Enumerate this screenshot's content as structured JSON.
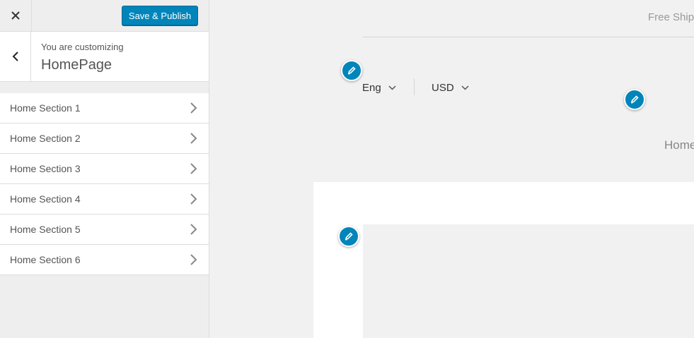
{
  "header": {
    "close_icon": "close-icon",
    "publish_label": "Save & Publish"
  },
  "info": {
    "customizing_label": "You are customizing",
    "page_title": "HomePage"
  },
  "sections": [
    {
      "label": "Home Section 1"
    },
    {
      "label": "Home Section 2"
    },
    {
      "label": "Home Section 3"
    },
    {
      "label": "Home Section 4"
    },
    {
      "label": "Home Section 5"
    },
    {
      "label": "Home Section 6"
    }
  ],
  "preview": {
    "free_shipping_text": "Free Shipp",
    "language": "Eng",
    "currency": "USD",
    "home_nav": "Home"
  },
  "colors": {
    "accent": "#0085ba"
  }
}
